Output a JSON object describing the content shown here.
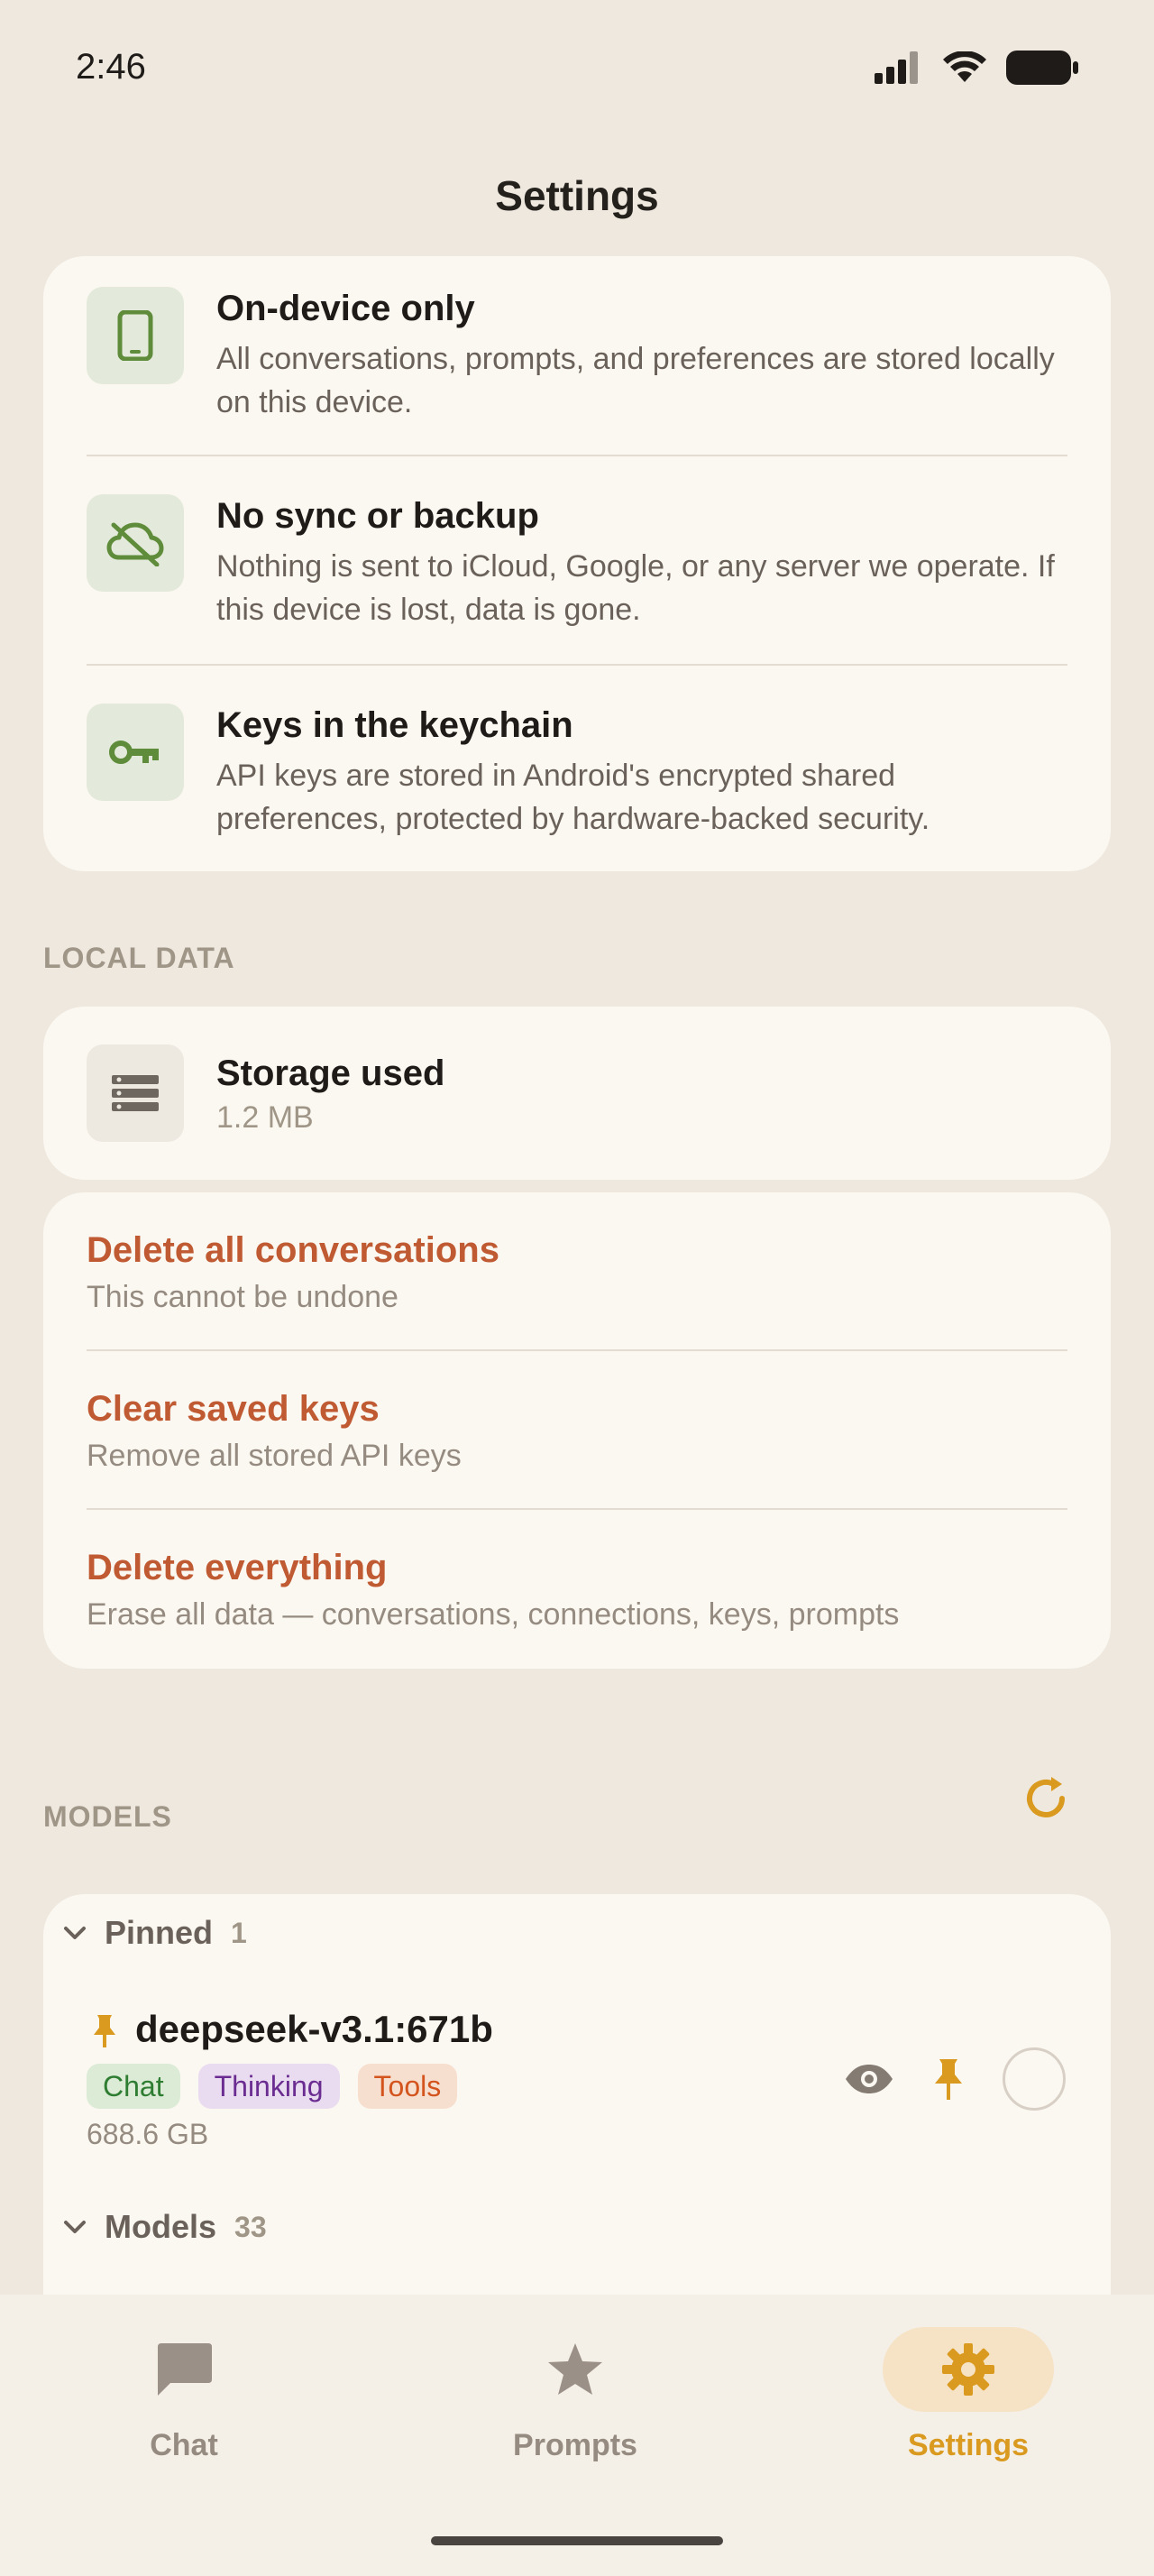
{
  "status_bar": {
    "time": "2:46"
  },
  "header": {
    "title": "Settings"
  },
  "privacy": [
    {
      "icon": "phone-icon",
      "title": "On-device only",
      "description": "All conversations, prompts, and preferences are stored locally on this device."
    },
    {
      "icon": "cloud-off-icon",
      "title": "No sync or backup",
      "description": "Nothing is sent to iCloud, Google, or any server we operate. If this device is lost, data is gone."
    },
    {
      "icon": "key-icon",
      "title": "Keys in the keychain",
      "description": "API keys are stored in Android's encrypted shared preferences, protected by hardware-backed security."
    }
  ],
  "local_data": {
    "header": "LOCAL DATA",
    "storage": {
      "icon": "storage-icon",
      "title": "Storage used",
      "value": "1.2 MB"
    },
    "actions": [
      {
        "title": "Delete all conversations",
        "subtitle": "This cannot be undone"
      },
      {
        "title": "Clear saved keys",
        "subtitle": "Remove all stored API keys"
      },
      {
        "title": "Delete everything",
        "subtitle": "Erase all data — conversations, connections, keys, prompts"
      }
    ]
  },
  "models": {
    "header": "MODELS",
    "pinned_group": {
      "label": "Pinned",
      "count": "1"
    },
    "pinned_model": {
      "name": "deepseek-v3.1:671b",
      "tags": [
        "Chat",
        "Thinking",
        "Tools"
      ],
      "size": "688.6 GB"
    },
    "models_group": {
      "label": "Models",
      "count": "33"
    }
  },
  "bottom_nav": [
    {
      "label": "Chat",
      "icon": "chat-icon",
      "active": false
    },
    {
      "label": "Prompts",
      "icon": "star-icon",
      "active": false
    },
    {
      "label": "Settings",
      "icon": "gear-icon",
      "active": true
    }
  ],
  "colors": {
    "background": "#EFE8DF",
    "card": "#FBF8F1",
    "accent": "#D99A1F",
    "danger": "#C05A32",
    "icon_green": "#5E8C3A"
  }
}
